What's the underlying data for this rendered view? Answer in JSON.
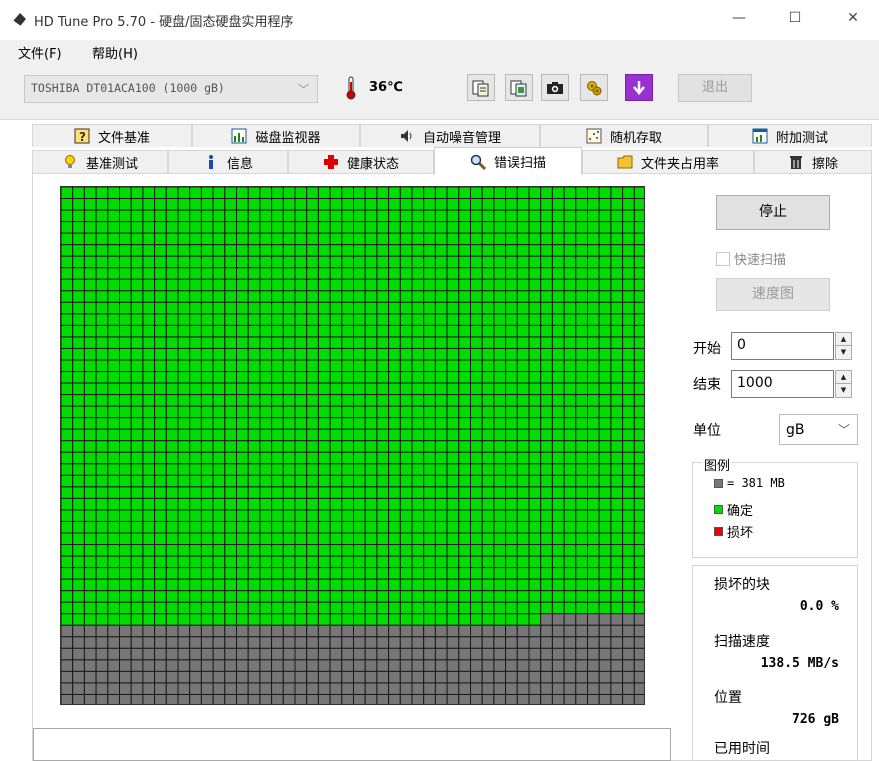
{
  "window": {
    "title": "HD Tune Pro 5.70 - 硬盘/固态硬盘实用程序",
    "minimize": "—",
    "maximize": "☐",
    "close": "✕"
  },
  "menu": {
    "file": "文件(F)",
    "help": "帮助(H)"
  },
  "toolbar": {
    "drive": "TOSHIBA DT01ACA100 (1000 gB)",
    "temperature": "36℃",
    "exit": "退出",
    "icons": [
      "copy-text-icon",
      "copy-screenshot-icon",
      "camera-icon",
      "options-icon",
      "save-icon"
    ]
  },
  "tabs": {
    "row1": [
      "文件基准",
      "磁盘监视器",
      "自动噪音管理",
      "随机存取",
      "附加测试"
    ],
    "row2": [
      "基准测试",
      "信息",
      "健康状态",
      "错误扫描",
      "文件夹占用率",
      "擦除"
    ],
    "active": "错误扫描"
  },
  "scan": {
    "stop": "停止",
    "quick_scan": "快速扫描",
    "quick_scan_checked": false,
    "speed_map": "速度图",
    "start_label": "开始",
    "start_value": "0",
    "end_label": "结束",
    "end_value": "1000",
    "unit_label": "单位",
    "unit_value": "gB",
    "legend_title": "图例",
    "legend_block": "= 381 MB",
    "legend_ok": "确定",
    "legend_bad": "损坏",
    "bad_blocks_label": "损坏的块",
    "bad_blocks_value": "0.0 %",
    "scan_speed_label": "扫描速度",
    "scan_speed_value": "138.5 MB/s",
    "position_label": "位置",
    "position_value": "726 gB",
    "elapsed_label": "已用时间"
  },
  "grid": {
    "columns": 50,
    "rows": 45,
    "scanned_blocks": 1891,
    "colors": {
      "ok": "#00dd00",
      "unscanned": "#777777",
      "bad": "#ee0000",
      "line": "#1a1a1a"
    }
  }
}
